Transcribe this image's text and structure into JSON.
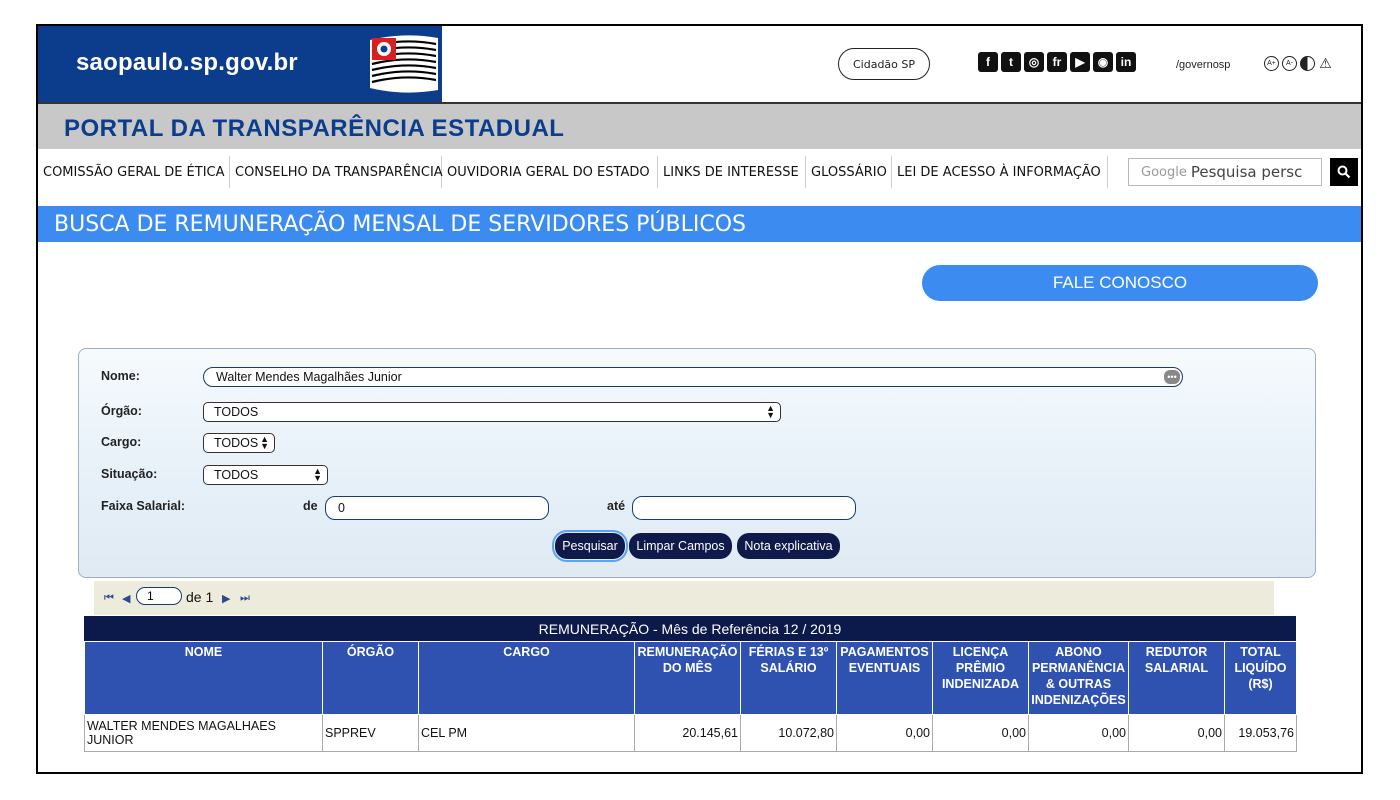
{
  "header": {
    "brand": "saopaulo.sp.gov.br",
    "cidadao_label": "Cidadão SP",
    "social_icons": [
      {
        "name": "facebook-icon",
        "glyph": "f"
      },
      {
        "name": "twitter-icon",
        "glyph": "t"
      },
      {
        "name": "instagram-icon",
        "glyph": "◎"
      },
      {
        "name": "flickr-icon",
        "glyph": "fr"
      },
      {
        "name": "youtube-icon",
        "glyph": "▶"
      },
      {
        "name": "periscope-icon",
        "glyph": "◉"
      },
      {
        "name": "linkedin-icon",
        "glyph": "in"
      }
    ],
    "social_handle": "/governosp",
    "accessibility_icons": [
      "A+",
      "A-",
      "",
      "⚠"
    ]
  },
  "portal": {
    "title": "PORTAL DA TRANSPARÊNCIA ESTADUAL"
  },
  "nav": {
    "items": [
      "COMISSÃO GERAL DE ÉTICA",
      "CONSELHO DA TRANSPARÊNCIA",
      "OUVIDORIA GERAL DO ESTADO",
      "LINKS DE INTERESSE",
      "GLOSSÁRIO",
      "LEI DE ACESSO À INFORMAÇÃO"
    ],
    "search_brand": "Google",
    "search_placeholder": "Pesquisa persc"
  },
  "page": {
    "title": "BUSCA DE REMUNERAÇÃO MENSAL DE SERVIDORES PÚBLICOS",
    "fale_conosco": "FALE CONOSCO"
  },
  "form": {
    "nome_label": "Nome:",
    "nome_value": "Walter Mendes Magalhães Junior",
    "orgao_label": "Órgão:",
    "orgao_value": "TODOS",
    "cargo_label": "Cargo:",
    "cargo_value": "TODOS",
    "situacao_label": "Situação:",
    "situacao_value": "TODOS",
    "faixa_label": "Faixa Salarial:",
    "de_label": "de",
    "de_value": "0",
    "ate_label": "até",
    "ate_value": "",
    "buttons": {
      "pesquisar": "Pesquisar",
      "limpar": "Limpar Campos",
      "nota": "Nota explicativa"
    }
  },
  "pager": {
    "current": "1",
    "total_text": "de 1"
  },
  "table": {
    "caption": "REMUNERAÇÃO - Mês de Referência 12 / 2019",
    "headers": [
      "NOME",
      "ÓRGÃO",
      "CARGO",
      "REMUNERAÇÃO DO MÊS",
      "FÉRIAS E 13º SALÁRIO",
      "PAGAMENTOS EVENTUAIS",
      "LICENÇA PRÊMIO INDENIZADA",
      "ABONO PERMANÊNCIA & OUTRAS INDENIZAÇÕES",
      "REDUTOR SALARIAL",
      "TOTAL LIQUÍDO (R$)"
    ],
    "rows": [
      [
        "WALTER MENDES MAGALHAES JUNIOR",
        "SPPREV",
        "CEL PM",
        "20.145,61",
        "10.072,80",
        "0,00",
        "0,00",
        "0,00",
        "0,00",
        "19.053,76"
      ]
    ]
  }
}
